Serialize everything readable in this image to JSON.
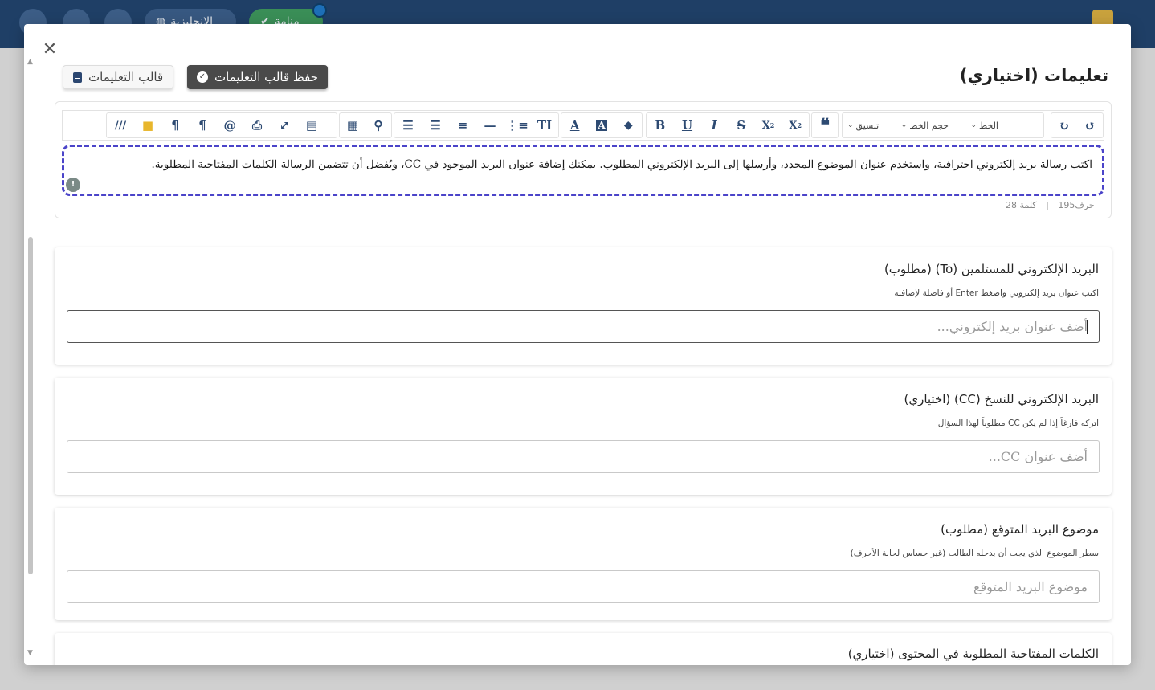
{
  "background": {
    "lang_label": "الإنجليزية",
    "status_label": "منامة"
  },
  "modal": {
    "title": "تعليمات (اختياري)",
    "close_icon": "close-icon",
    "save_button": "حفظ قالب التعليمات",
    "template_button": "قالب التعليمات"
  },
  "editor": {
    "selects": {
      "format": "تنسيق",
      "font_size": "حجم الخط",
      "font": "الخط"
    },
    "toolbar_icons": [
      "undo-icon",
      "redo-icon",
      "blockquote-icon",
      "superscript-icon",
      "subscript-icon",
      "strikethrough-icon",
      "italic-icon",
      "underline-icon",
      "bold-icon",
      "eraser-icon",
      "highlight-icon",
      "font-color-icon",
      "text-size-icon",
      "ordered-list-icon",
      "horizontal-rule-icon",
      "align-icon",
      "indent-icon",
      "outdent-icon",
      "link-icon",
      "table-icon",
      "template-icon",
      "fullscreen-icon",
      "print-icon",
      "mention-icon",
      "rtl-icon",
      "ltr-icon",
      "folder-icon",
      "special-char-icon"
    ],
    "content": "اكتب رسالة بريد إلكتروني احترافية، واستخدم عنوان الموضوع المحدد، وأرسلها إلى البريد الإلكتروني المطلوب. يمكنك إضافة عنوان البريد الموجود في CC، ويُفضل أن تتضمن الرسالة الكلمات المفتاحية المطلوبة.",
    "char_count": "حرف195",
    "separator": "|",
    "word_count": "كلمة 28"
  },
  "fields": {
    "to": {
      "label": "البريد الإلكتروني للمستلمين (To) (مطلوب)",
      "hint": "اكتب عنوان بريد إلكتروني واضغط Enter أو فاصلة لإضافته",
      "placeholder": "أضف عنوان بريد إلكتروني..."
    },
    "cc": {
      "label": "البريد الإلكتروني للنسخ (CC) (اختياري)",
      "hint": "اتركه فارغاً إذا لم يكن CC مطلوباً لهذا السؤال",
      "placeholder": "أضف عنوان CC..."
    },
    "subject": {
      "label": "موضوع البريد المتوقع (مطلوب)",
      "hint": "سطر الموضوع الذي يجب أن يدخله الطالب (غير حساس لحالة الأحرف)",
      "placeholder": "موضوع البريد المتوقع"
    },
    "keywords": {
      "label": "الكلمات المفتاحية المطلوبة في المحتوى (اختياري)"
    }
  }
}
